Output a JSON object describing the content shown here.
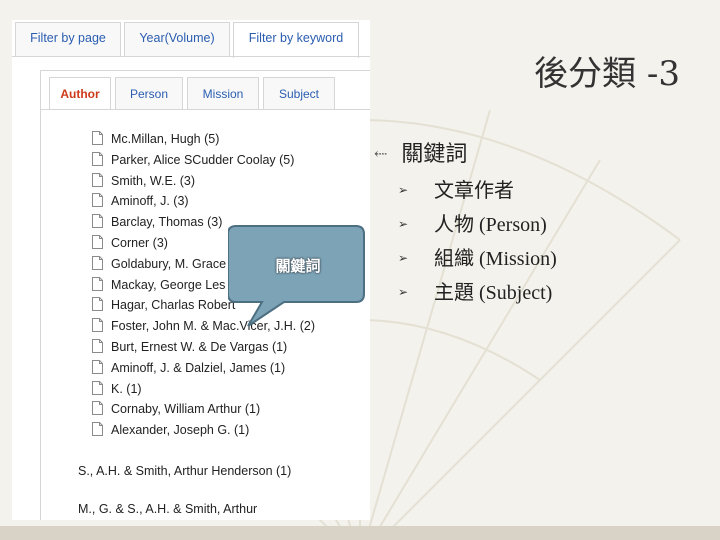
{
  "slide": {
    "title": "後分類 -3",
    "bullet": "關鍵詞",
    "sub_bullets": [
      "文章作者",
      "人物 (Person)",
      "組織 (Mission)",
      "主題 (Subject)"
    ]
  },
  "panel": {
    "top_tabs": [
      "Filter by page",
      "Year(Volume)",
      "Filter by keyword"
    ],
    "active_top_tab": "Filter by keyword",
    "sub_tabs": [
      "Author",
      "Person",
      "Mission",
      "Subject"
    ],
    "active_sub_tab": "Author",
    "author_items": [
      "Mc.Millan, Hugh (5)",
      "Parker, Alice SCudder Coolay (5)",
      "Smith, W.E. (3)",
      "Aminoff, J. (3)",
      "Barclay, Thomas (3)",
      "Corner (3)",
      "Goldabury, M. Grace",
      "Mackay, George Les",
      "Hagar, Charlas Robert",
      "Foster, John M. & Mac.Vicer, J.H. (2)",
      "Burt, Ernest W. & De Vargas (1)",
      "Aminoff, J. & Dalziel, James (1)",
      "K. (1)",
      "Cornaby, William Arthur (1)",
      "Alexander, Joseph G. (1)"
    ],
    "plain_items": [
      "S., A.H. & Smith, Arthur Henderson (1)",
      "M., G. & S., A.H. & Smith, Arthur"
    ]
  },
  "callout": {
    "text": "關鍵詞"
  },
  "colors": {
    "accent_tab_active": "#cc3a1a",
    "tab_link": "#2a5db0",
    "callout_fill": "#7da3b6"
  }
}
